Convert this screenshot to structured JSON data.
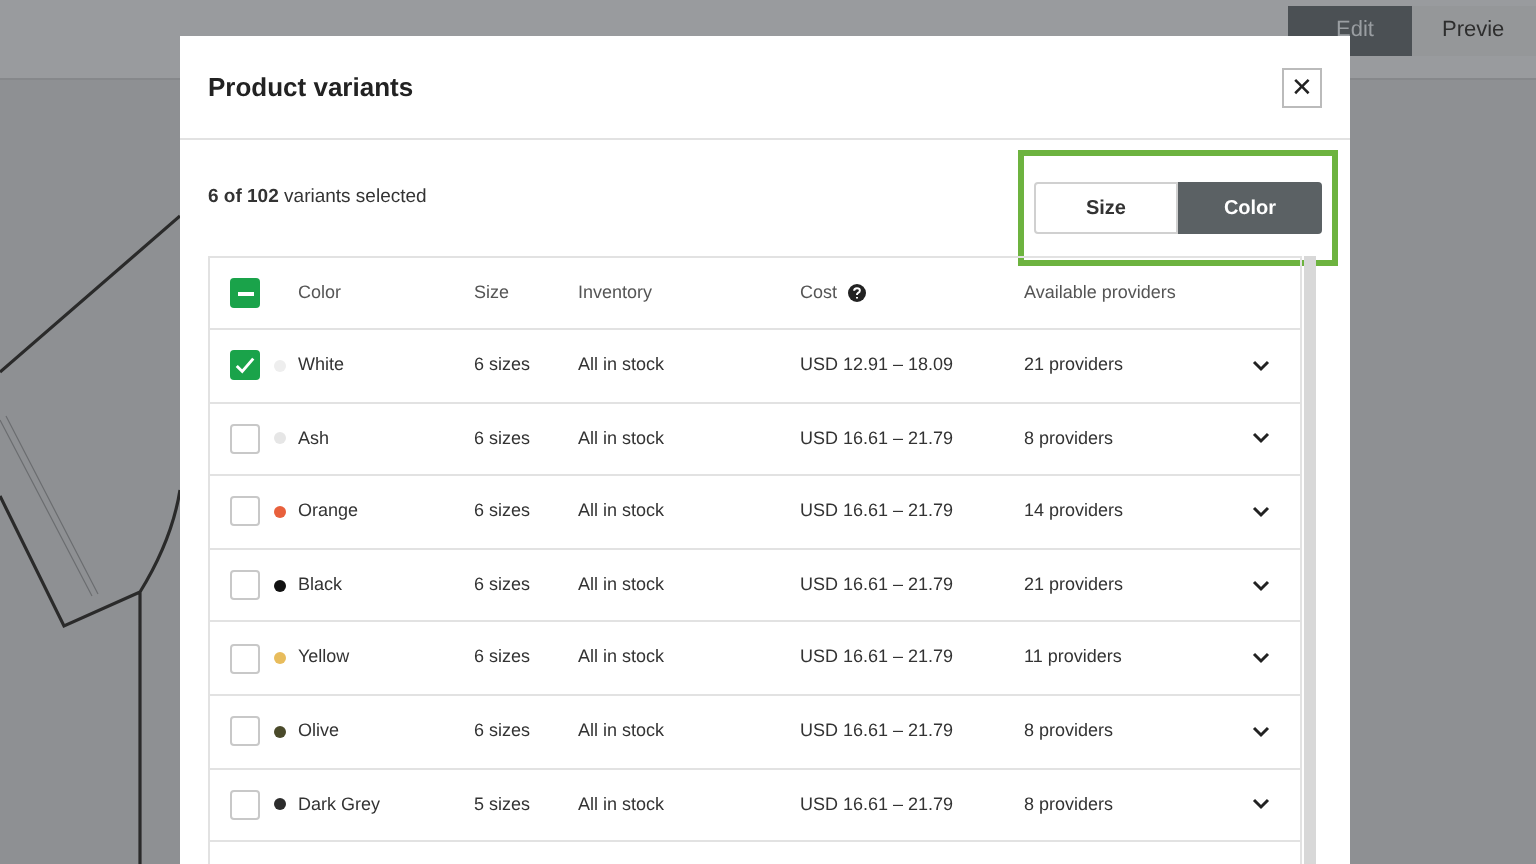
{
  "top_tabs": [
    {
      "label": "Edit",
      "selected": true
    },
    {
      "label": "Previe",
      "selected": false
    }
  ],
  "dialog": {
    "title": "Product variants",
    "close": "✕"
  },
  "summary": "**6 of 102** variants selected",
  "view_toggle": [
    {
      "label": "Size",
      "selected": false
    },
    {
      "label": "Color",
      "selected": true
    }
  ],
  "table": {
    "select_all": {
      "indeterminate": true
    },
    "columns": [
      "Color",
      "Size",
      "Inventory",
      "Cost",
      "Available providers"
    ],
    "rows": [
      {
        "checked": true,
        "color": "#eeeeee",
        "name": "White",
        "size": "6 sizes",
        "inventory": "All in stock",
        "cost": "USD 12.91 – 18.09",
        "providers": "21 providers"
      },
      {
        "checked": false,
        "color": "#e6e6e6",
        "name": "Ash",
        "size": "6 sizes",
        "inventory": "All in stock",
        "cost": "USD 16.61 – 21.79",
        "providers": "8 providers"
      },
      {
        "checked": false,
        "color": "#e8603c",
        "name": "Orange",
        "size": "6 sizes",
        "inventory": "All in stock",
        "cost": "USD 16.61 – 21.79",
        "providers": "14 providers"
      },
      {
        "checked": false,
        "color": "#111111",
        "name": "Black",
        "size": "6 sizes",
        "inventory": "All in stock",
        "cost": "USD 16.61 – 21.79",
        "providers": "21 providers"
      },
      {
        "checked": false,
        "color": "#e8bc5c",
        "name": "Yellow",
        "size": "6 sizes",
        "inventory": "All in stock",
        "cost": "USD 16.61 – 21.79",
        "providers": "11 providers"
      },
      {
        "checked": false,
        "color": "#4a4a2a",
        "name": "Olive",
        "size": "6 sizes",
        "inventory": "All in stock",
        "cost": "USD 16.61 – 21.79",
        "providers": "8 providers"
      },
      {
        "checked": false,
        "color": "#2c2c2c",
        "name": "Dark Grey",
        "size": "5 sizes",
        "inventory": "All in stock",
        "cost": "USD 16.61 – 21.79",
        "providers": "8 providers"
      }
    ]
  }
}
